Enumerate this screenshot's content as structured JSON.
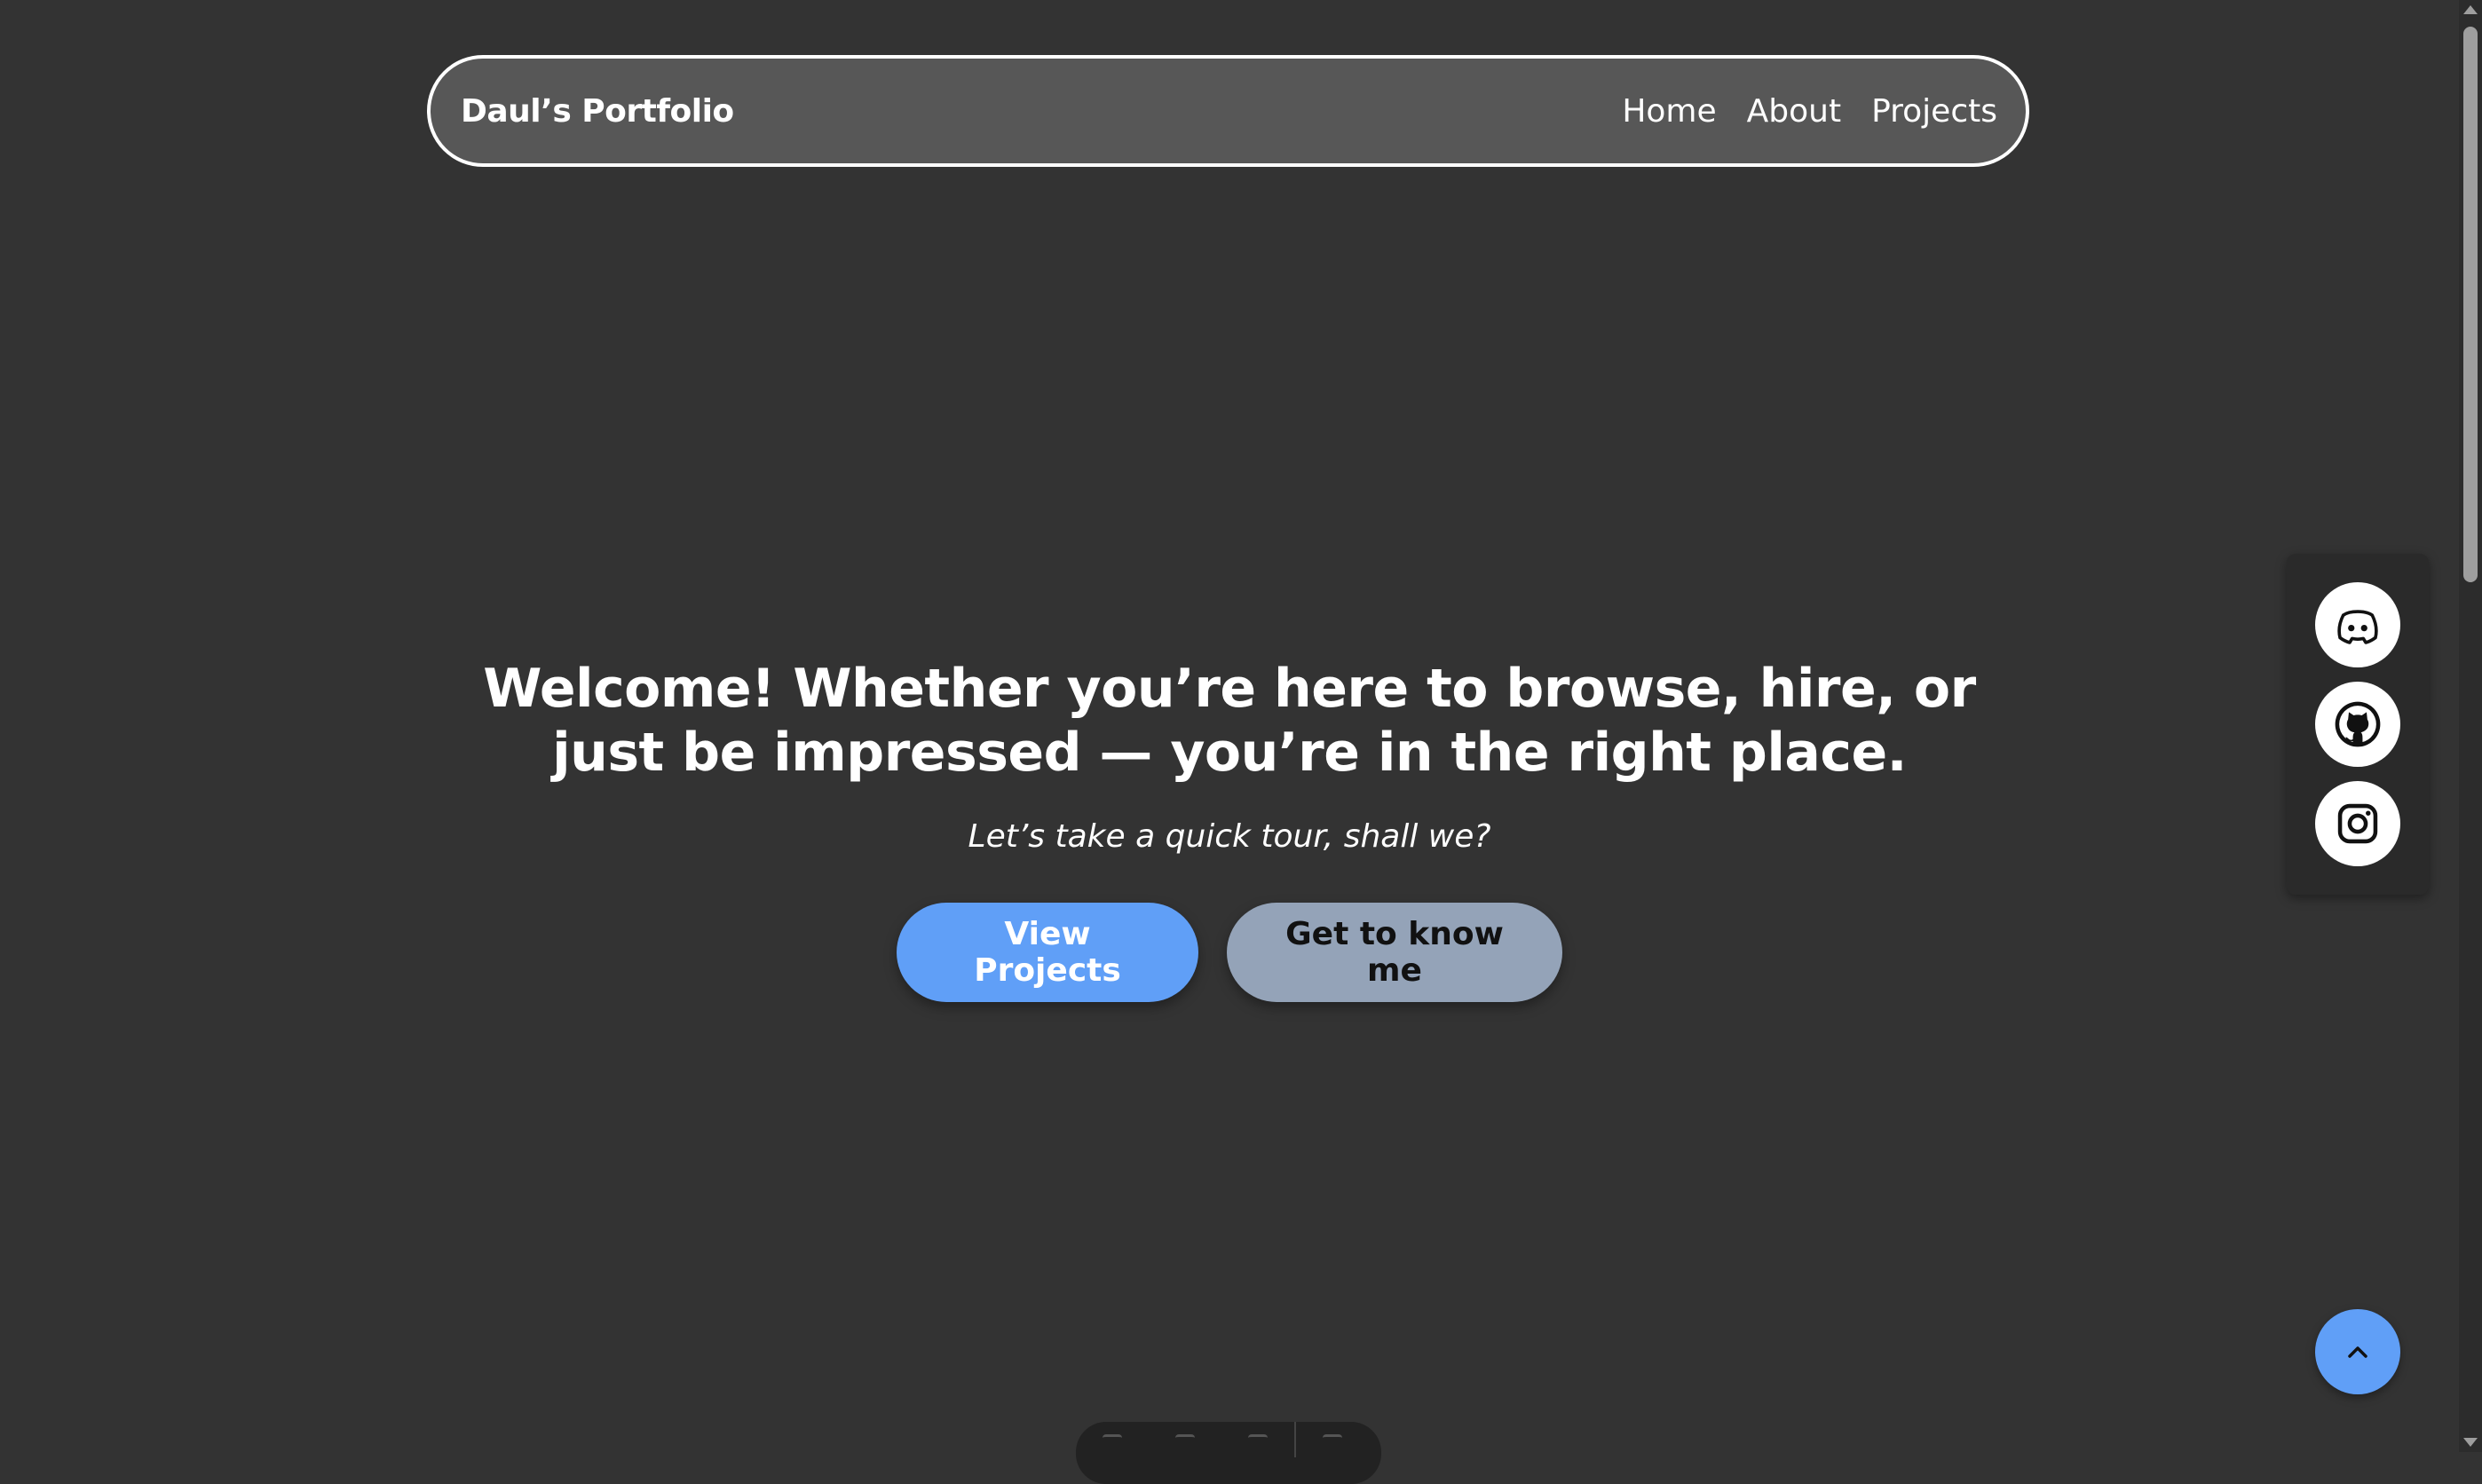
{
  "navbar": {
    "brand": "Daul’s Portfolio",
    "links": [
      "Home",
      "About",
      "Projects"
    ]
  },
  "hero": {
    "title": "Welcome! Whether you’re here to browse, hire, or just be impressed — you’re in the right place.",
    "subtitle": "Let’s take a quick tour, shall we?",
    "primary_button": "View Projects",
    "secondary_button": "Get to know me"
  },
  "social": {
    "icons": [
      "discord-icon",
      "github-icon",
      "instagram-icon"
    ]
  },
  "colors": {
    "background": "#333333",
    "navbar_bg": "#575757",
    "primary": "#609ff7",
    "secondary": "#94a3b8"
  }
}
